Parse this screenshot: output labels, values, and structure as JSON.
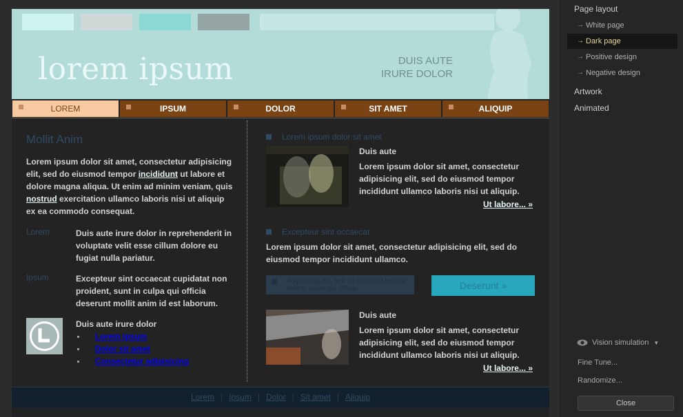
{
  "colors": {
    "header_bg": "#b3dbd8",
    "nav_bg": "#7a4313",
    "nav_active_bg": "#f7caa1",
    "accent_blue": "#2f4a63",
    "cta_bg": "#29a7bd",
    "sidebar_selected_text": "#e6d79b"
  },
  "header": {
    "swatch_colors": [
      "#cff5f2",
      "#cfd8d7",
      "#8cd8d4",
      "#94a4a3"
    ],
    "title": "lorem ipsum",
    "subtitle_line1": "DUIS AUTE",
    "subtitle_line2": "IRURE DOLOR"
  },
  "nav": {
    "items": [
      {
        "label": "LOREM",
        "active": true
      },
      {
        "label": "IPSUM",
        "active": false
      },
      {
        "label": "DOLOR",
        "active": false
      },
      {
        "label": "SIT AMET",
        "active": false
      },
      {
        "label": "ALIQUIP",
        "active": false
      }
    ]
  },
  "left": {
    "title": "Mollit Anim",
    "intro_part1": "Lorem ipsum dolor sit amet, consectetur adipisicing elit, sed do eiusmod tempor ",
    "intro_link1": "incididunt",
    "intro_part2": " ut labore et dolore magna aliqua. Ut enim ad minim veniam, quis ",
    "intro_link2": "nostrud",
    "intro_part3": " exercitation ullamco laboris nisi ut aliquip ex ea commodo consequat.",
    "defs": [
      {
        "term": "Lorem",
        "desc": "Duis aute irure dolor in reprehenderit in voluptate velit esse cillum dolore eu fugiat nulla pariatur."
      },
      {
        "term": "Ipsum",
        "desc": "Excepteur sint occaecat cupidatat non proident, sunt in culpa qui officia deserunt mollit anim id est laborum."
      }
    ],
    "icon_heading": "Duis aute irure dolor",
    "icon_links": [
      "Lorem ipsum",
      "Dolor sit amet",
      "Consectetur adipisicing"
    ],
    "clock_icon": "clock-icon"
  },
  "right": {
    "section1_title": "Lorem ipsum dolor sit amet",
    "media1": {
      "title": "Duis aute",
      "text": "Lorem ipsum dolor sit amet, consectetur adipisicing elit, sed do eiusmod tempor incididunt ullamco laboris nisi ut aliquip.",
      "more": "Ut labore... »"
    },
    "section2_title": "Excepteur sint occaecat",
    "section2_text": "Lorem ipsum dolor sit amet, consectetur adipisicing elit, sed do eiusmod tempor incididunt ullamco.",
    "note": "Adipisicing elit, sed do eiusmod tempor sunt in culpa qui officia.",
    "cta": "Deserunt »",
    "media2": {
      "title": "Duis aute",
      "text": "Lorem ipsum dolor sit amet, consectetur adipisicing elit, sed do eiusmod tempor incididunt ullamco laboris nisi ut aliquip.",
      "more": "Ut labore... »"
    }
  },
  "footer": {
    "links": [
      "Lorem",
      "Ipsum",
      "Dolor",
      "Sit amet",
      "Aliquip"
    ],
    "separator": "|"
  },
  "sidebar": {
    "heading": "Page layout",
    "layout_items": [
      {
        "label": "White page",
        "selected": false
      },
      {
        "label": "Dark page",
        "selected": true
      },
      {
        "label": "Positive design",
        "selected": false
      },
      {
        "label": "Negative design",
        "selected": false
      }
    ],
    "artwork": "Artwork",
    "animated": "Animated",
    "vision": "Vision simulation",
    "fine_tune": "Fine Tune...",
    "randomize": "Randomize...",
    "close": "Close"
  }
}
